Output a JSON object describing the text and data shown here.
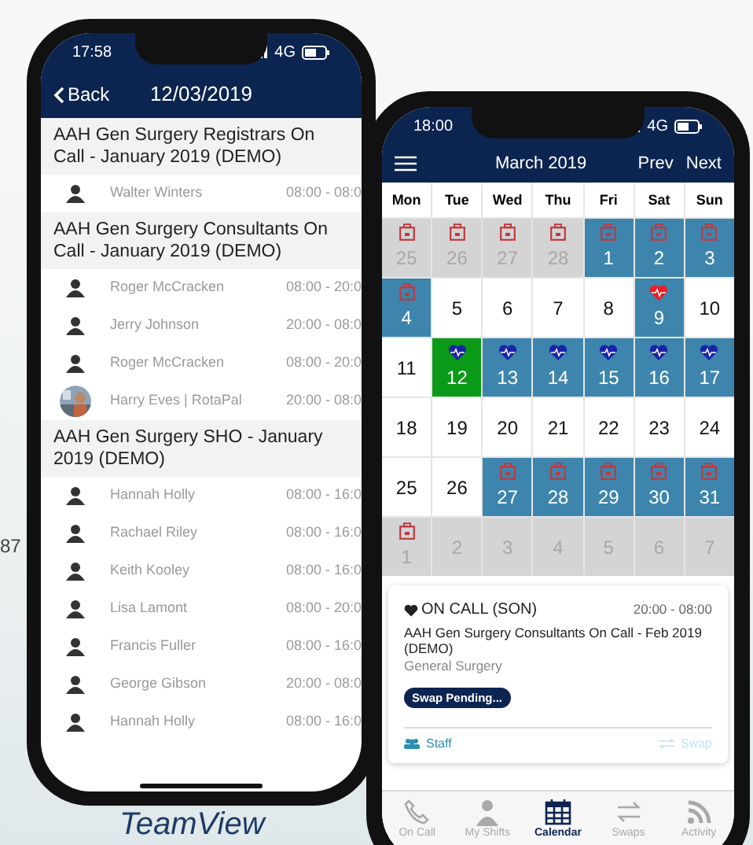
{
  "background": {
    "edge_text": "87",
    "caption": "TeamView"
  },
  "left_phone": {
    "status": {
      "time": "17:58",
      "network": "4G"
    },
    "header": {
      "back": "Back",
      "title": "12/03/2019"
    },
    "groups": [
      {
        "title": "AAH Gen Surgery Registrars On Call - January 2019 (DEMO)",
        "shifts": [
          {
            "name": "Walter Winters",
            "time": "08:00 - 08:0",
            "kind": "person"
          }
        ]
      },
      {
        "title": "AAH Gen Surgery Consultants On Call - January 2019 (DEMO)",
        "shifts": [
          {
            "name": "Roger McCracken",
            "time": "08:00 - 20:0",
            "kind": "person"
          },
          {
            "name": "Jerry Johnson",
            "time": "20:00 - 08:0",
            "kind": "person"
          },
          {
            "name": "Roger McCracken",
            "time": "08:00 - 20:0",
            "kind": "person"
          },
          {
            "name": "Harry Eves | RotaPal",
            "time": "20:00 - 08:0"
          }
        ]
      },
      {
        "title": "AAH Gen Surgery SHO - January 2019 (DEMO)",
        "shifts": [
          {
            "name": "Hannah Holly",
            "time": "08:00 - 16:0",
            "kind": "person"
          },
          {
            "name": "Rachael Riley",
            "time": "08:00 - 16:0",
            "kind": "person"
          },
          {
            "name": "Keith Kooley",
            "time": "08:00 - 16:0",
            "kind": "person"
          },
          {
            "name": "Lisa Lamont",
            "time": "08:00 - 20:0",
            "kind": "person"
          },
          {
            "name": "Francis Fuller",
            "time": "08:00 - 16:0",
            "kind": "person"
          },
          {
            "name": "George Gibson",
            "time": "20:00 - 08:0",
            "kind": "person"
          },
          {
            "name": "Hannah Holly",
            "time": "08:00 - 16:0",
            "kind": "person"
          }
        ]
      }
    ]
  },
  "right_phone": {
    "status": {
      "time": "18:00",
      "network": "4G"
    },
    "header": {
      "title": "March 2019",
      "prev": "Prev",
      "next": "Next"
    },
    "weekdays": [
      "Mon",
      "Tue",
      "Wed",
      "Thu",
      "Fri",
      "Sat",
      "Sun"
    ],
    "weeks": [
      [
        {
          "day": "25",
          "kind": "other-bag"
        },
        {
          "day": "26",
          "kind": "other-bag"
        },
        {
          "day": "27",
          "kind": "other-bag"
        },
        {
          "day": "28",
          "kind": "other-bag"
        },
        {
          "day": "1",
          "kind": "shift-bag"
        },
        {
          "day": "2",
          "kind": "shift-bag"
        },
        {
          "day": "3",
          "kind": "shift-bag"
        }
      ],
      [
        {
          "day": "4",
          "kind": "shift-bag"
        },
        {
          "day": "5",
          "kind": "free"
        },
        {
          "day": "6",
          "kind": "free"
        },
        {
          "day": "7",
          "kind": "free"
        },
        {
          "day": "8",
          "kind": "free"
        },
        {
          "day": "9",
          "kind": "shift-alert"
        },
        {
          "day": "10",
          "kind": "free"
        }
      ],
      [
        {
          "day": "11",
          "kind": "free"
        },
        {
          "day": "12",
          "kind": "today-heart"
        },
        {
          "day": "13",
          "kind": "shift-heart"
        },
        {
          "day": "14",
          "kind": "shift-heart"
        },
        {
          "day": "15",
          "kind": "shift-heart"
        },
        {
          "day": "16",
          "kind": "shift-heart"
        },
        {
          "day": "17",
          "kind": "shift-heart"
        }
      ],
      [
        {
          "day": "18",
          "kind": "free"
        },
        {
          "day": "19",
          "kind": "free"
        },
        {
          "day": "20",
          "kind": "free"
        },
        {
          "day": "21",
          "kind": "free"
        },
        {
          "day": "22",
          "kind": "free"
        },
        {
          "day": "23",
          "kind": "free"
        },
        {
          "day": "24",
          "kind": "free"
        }
      ],
      [
        {
          "day": "25",
          "kind": "free"
        },
        {
          "day": "26",
          "kind": "free"
        },
        {
          "day": "27",
          "kind": "shift-bag"
        },
        {
          "day": "28",
          "kind": "shift-bag"
        },
        {
          "day": "29",
          "kind": "shift-bag"
        },
        {
          "day": "30",
          "kind": "shift-bag"
        },
        {
          "day": "31",
          "kind": "shift-bag"
        }
      ],
      [
        {
          "day": "1",
          "kind": "other-bag"
        },
        {
          "day": "2",
          "kind": "other"
        },
        {
          "day": "3",
          "kind": "other"
        },
        {
          "day": "4",
          "kind": "other"
        },
        {
          "day": "5",
          "kind": "other"
        },
        {
          "day": "6",
          "kind": "other"
        },
        {
          "day": "7",
          "kind": "other"
        }
      ]
    ],
    "card": {
      "type": "ON CALL (SON)",
      "time": "20:00 - 08:00",
      "title": "AAH Gen Surgery Consultants On Call - Feb 2019 (DEMO)",
      "department": "General Surgery",
      "badge": "Swap Pending...",
      "staff": "Staff",
      "swap": {
        "label": "Swap",
        "disabled": true
      }
    },
    "tabs": [
      {
        "label": "On Call",
        "kind": "phone",
        "selected": false
      },
      {
        "label": "My Shifts",
        "kind": "doctor",
        "selected": false
      },
      {
        "label": "Calendar",
        "kind": "calendar",
        "selected": true
      },
      {
        "label": "Swaps",
        "kind": "swap",
        "selected": false
      },
      {
        "label": "Activity",
        "kind": "feed",
        "selected": false
      }
    ]
  }
}
